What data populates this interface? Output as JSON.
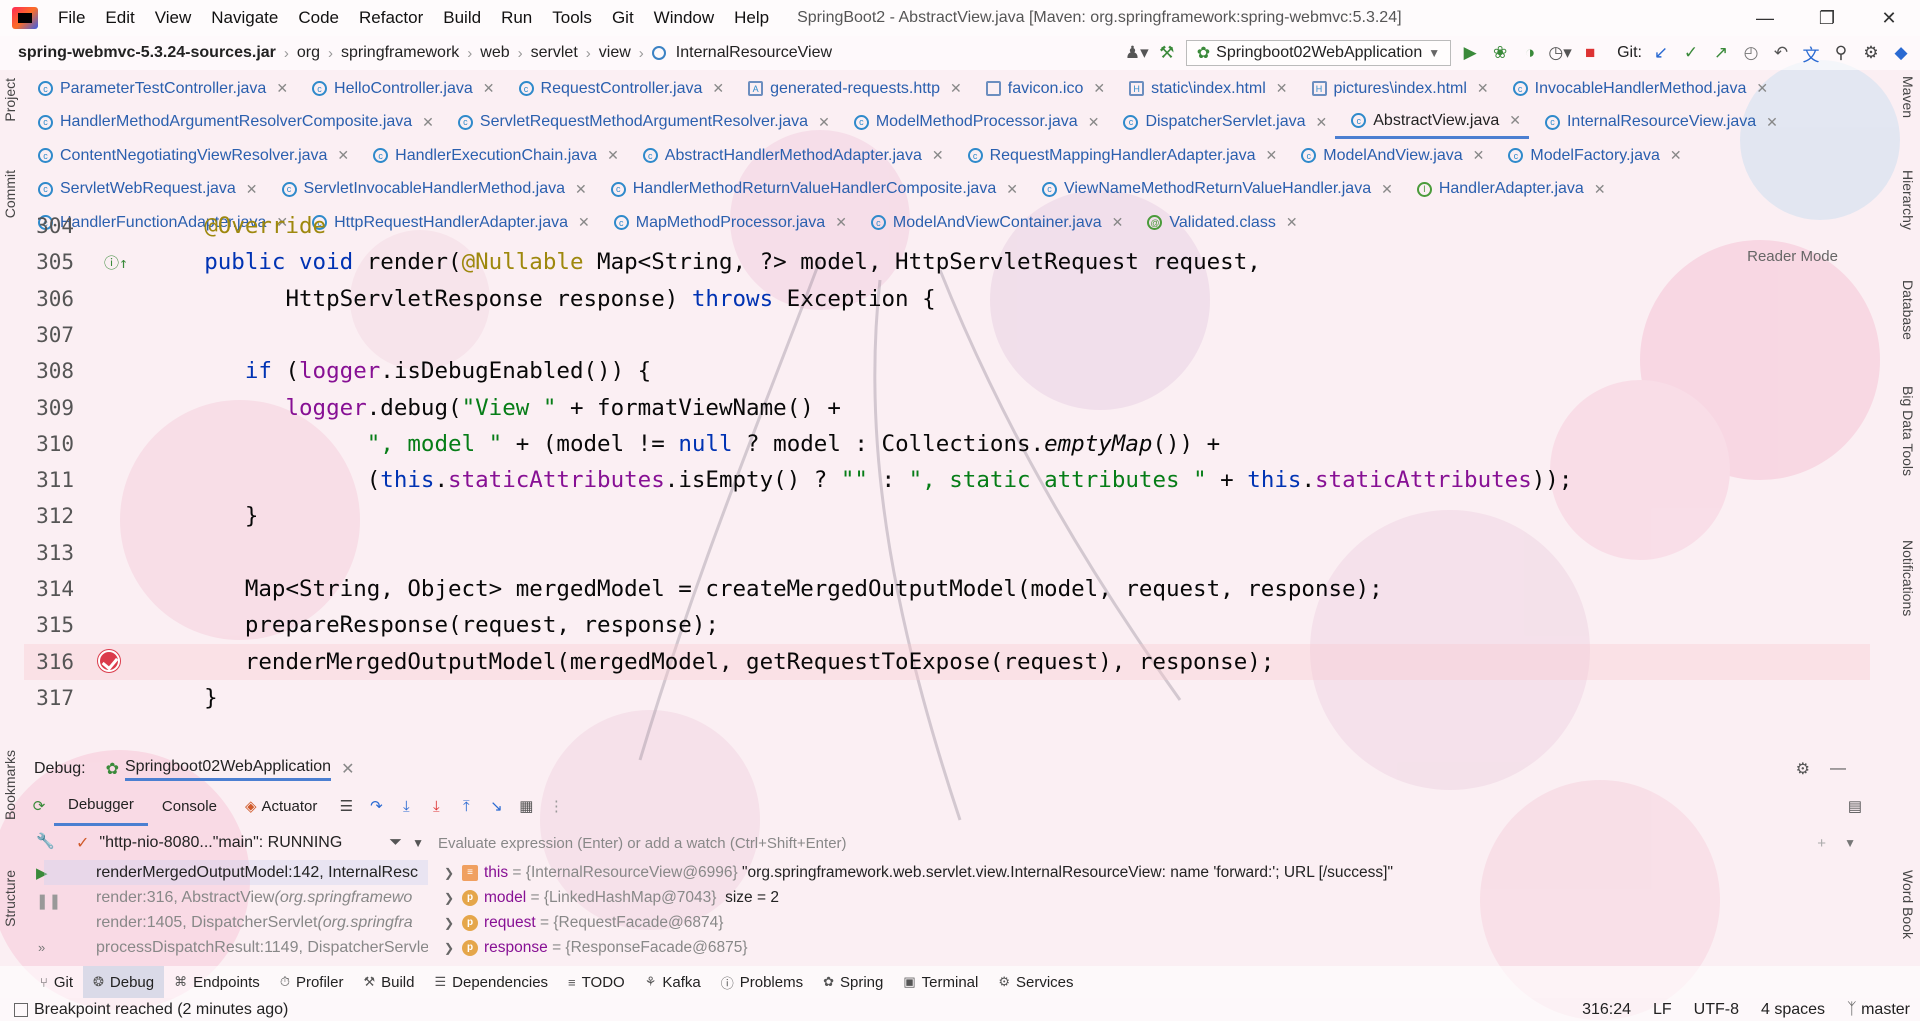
{
  "window": {
    "title": "SpringBoot2 - AbstractView.java [Maven: org.springframework:spring-webmvc:5.3.24]",
    "menu": [
      "File",
      "Edit",
      "View",
      "Navigate",
      "Code",
      "Refactor",
      "Build",
      "Run",
      "Tools",
      "Git",
      "Window",
      "Help"
    ]
  },
  "breadcrumb": {
    "items": [
      "spring-webmvc-5.3.24-sources.jar",
      "org",
      "springframework",
      "web",
      "servlet",
      "view",
      "InternalResourceView"
    ]
  },
  "toolbar": {
    "run_config": "Springboot02WebApplication",
    "git_label": "Git:"
  },
  "tabs": {
    "rows": [
      [
        {
          "label": "ParameterTestController.java",
          "icon": "class"
        },
        {
          "label": "HelloController.java",
          "icon": "class"
        },
        {
          "label": "RequestController.java",
          "icon": "class"
        },
        {
          "label": "generated-requests.http",
          "icon": "api"
        },
        {
          "label": "favicon.ico",
          "icon": "image"
        },
        {
          "label": "static\\index.html",
          "icon": "html"
        },
        {
          "label": "pictures\\index.html",
          "icon": "html"
        },
        {
          "label": "InvocableHandlerMethod.java",
          "icon": "class"
        }
      ],
      [
        {
          "label": "HandlerMethodArgumentResolverComposite.java",
          "icon": "class"
        },
        {
          "label": "ServletRequestMethodArgumentResolver.java",
          "icon": "class"
        },
        {
          "label": "ModelMethodProcessor.java",
          "icon": "class"
        },
        {
          "label": "DispatcherServlet.java",
          "icon": "class"
        },
        {
          "label": "AbstractView.java",
          "icon": "class",
          "selected": true
        },
        {
          "label": "InternalResourceView.java",
          "icon": "class"
        }
      ],
      [
        {
          "label": "ContentNegotiatingViewResolver.java",
          "icon": "class"
        },
        {
          "label": "HandlerExecutionChain.java",
          "icon": "class"
        },
        {
          "label": "AbstractHandlerMethodAdapter.java",
          "icon": "class"
        },
        {
          "label": "RequestMappingHandlerAdapter.java",
          "icon": "class"
        },
        {
          "label": "ModelAndView.java",
          "icon": "class"
        },
        {
          "label": "ModelFactory.java",
          "icon": "class"
        }
      ],
      [
        {
          "label": "ServletWebRequest.java",
          "icon": "class"
        },
        {
          "label": "ServletInvocableHandlerMethod.java",
          "icon": "class"
        },
        {
          "label": "HandlerMethodReturnValueHandlerComposite.java",
          "icon": "class"
        },
        {
          "label": "ViewNameMethodReturnValueHandler.java",
          "icon": "class"
        },
        {
          "label": "HandlerAdapter.java",
          "icon": "interface"
        }
      ],
      [
        {
          "label": "HandlerFunctionAdapter.java",
          "icon": "class"
        },
        {
          "label": "HttpRequestHandlerAdapter.java",
          "icon": "class"
        },
        {
          "label": "MapMethodProcessor.java",
          "icon": "class"
        },
        {
          "label": "ModelAndViewContainer.java",
          "icon": "class"
        },
        {
          "label": "Validated.class",
          "icon": "annotation"
        }
      ]
    ]
  },
  "editor": {
    "reader_mode": "Reader Mode",
    "lines": [
      {
        "num": "304",
        "html": "    <span class='ann'>@Override</span>"
      },
      {
        "num": "305",
        "html": "    <span class='kw'>public void</span> render(<span class='ann'>@Nullable</span> Map&lt;String, ?&gt; model, HttpServletRequest request,"
      },
      {
        "num": "306",
        "html": "          HttpServletResponse response) <span class='kw'>throws</span> Exception {"
      },
      {
        "num": "307",
        "html": ""
      },
      {
        "num": "308",
        "html": "       <span class='kw'>if</span> (<span class='fld'>logger</span>.isDebugEnabled()) {"
      },
      {
        "num": "309",
        "html": "          <span class='fld'>logger</span>.debug(<span class='str'>\"View \"</span> + formatViewName() +"
      },
      {
        "num": "310",
        "html": "                <span class='str'>\", model \"</span> + (model != <span class='kw'>null</span> ? model : Collections.<span class='it'>emptyMap</span>()) +"
      },
      {
        "num": "311",
        "html": "                (<span class='kw'>this</span>.<span class='fld'>staticAttributes</span>.isEmpty() ? <span class='str'>\"\"</span> : <span class='str'>\", static attributes \"</span> + <span class='kw'>this</span>.<span class='fld'>staticAttributes</span>));"
      },
      {
        "num": "312",
        "html": "       }"
      },
      {
        "num": "313",
        "html": ""
      },
      {
        "num": "314",
        "html": "       Map&lt;String, Object&gt; mergedModel = createMergedOutputModel(model, request, response);"
      },
      {
        "num": "315",
        "html": "       prepareResponse(request, response);"
      },
      {
        "num": "316",
        "html": "       renderMergedOutputModel(mergedModel, getRequestToExpose(request), response);"
      },
      {
        "num": "317",
        "html": "    }"
      }
    ]
  },
  "debug": {
    "label": "Debug:",
    "session": "Springboot02WebApplication",
    "tabs": [
      "Debugger",
      "Console",
      "Actuator"
    ],
    "thread": "\"http-nio-8080...\"main\": RUNNING",
    "eval_placeholder": "Evaluate expression (Enter) or add a watch (Ctrl+Shift+Enter)",
    "frames": [
      {
        "method": "renderMergedOutputModel:142, InternalResc",
        "selected": true
      },
      {
        "method": "render:316, AbstractView ",
        "pkg": "(org.springframewo"
      },
      {
        "method": "render:1405, DispatcherServlet ",
        "pkg": "(org.springfra"
      },
      {
        "method": "processDispatchResult:1149, DispatcherServle"
      }
    ],
    "variables": [
      {
        "name": "this",
        "type": " = {InternalResourceView@6996} ",
        "value": "\"org.springframework.web.servlet.view.InternalResourceView: name 'forward:'; URL [/success]\"",
        "icon": "list"
      },
      {
        "name": "model",
        "type": " = {LinkedHashMap@7043} ",
        "value": " size = 2",
        "icon": "p"
      },
      {
        "name": "request",
        "type": " = {RequestFacade@6874}",
        "value": "",
        "icon": "p"
      },
      {
        "name": "response",
        "type": " = {ResponseFacade@6875}",
        "value": "",
        "icon": "p"
      }
    ]
  },
  "toolwindows": [
    "Git",
    "Debug",
    "Endpoints",
    "Profiler",
    "Build",
    "Dependencies",
    "TODO",
    "Kafka",
    "Problems",
    "Spring",
    "Terminal",
    "Services"
  ],
  "left_panels": [
    "Project",
    "Commit",
    "Bookmarks",
    "Structure"
  ],
  "right_panels": [
    "Maven",
    "Hierarchy",
    "Database",
    "Big Data Tools",
    "Notifications",
    "Word Book"
  ],
  "status": {
    "message": "Breakpoint reached (2 minutes ago)",
    "position": "316:24",
    "line_sep": "LF",
    "encoding": "UTF-8",
    "indent": "4 spaces",
    "branch": "master"
  }
}
